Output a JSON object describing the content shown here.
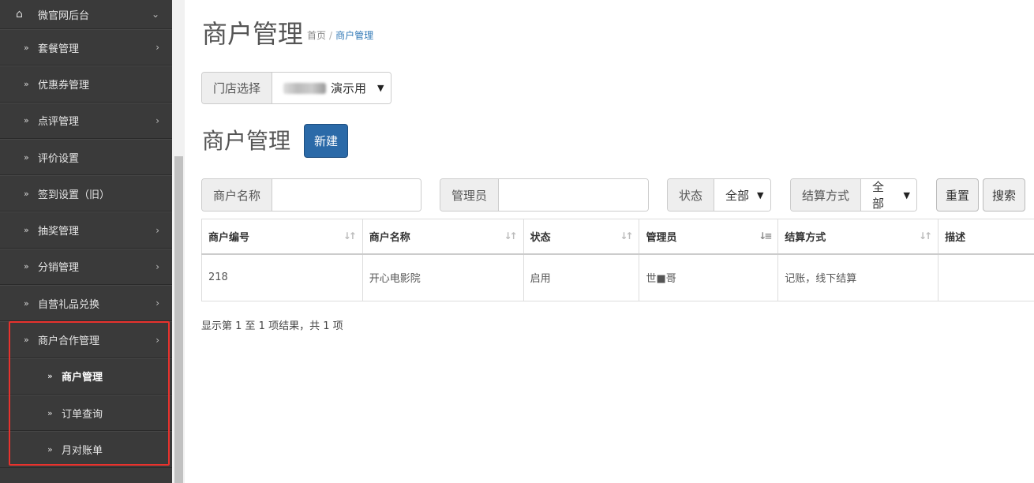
{
  "sidebar": {
    "top": {
      "label": "微官网后台",
      "icon": "home-icon"
    },
    "items": [
      {
        "label": "套餐管理",
        "has_arrow": true
      },
      {
        "label": "优惠券管理",
        "has_arrow": false
      },
      {
        "label": "点评管理",
        "has_arrow": true
      },
      {
        "label": "评价设置",
        "has_arrow": false
      },
      {
        "label": "签到设置（旧）",
        "has_arrow": false
      },
      {
        "label": "抽奖管理",
        "has_arrow": true
      },
      {
        "label": "分销管理",
        "has_arrow": true
      },
      {
        "label": "自营礼品兑换",
        "has_arrow": true
      },
      {
        "label": "商户合作管理",
        "has_arrow": true
      }
    ],
    "sub_items": [
      {
        "label": "商户管理",
        "active": true
      },
      {
        "label": "订单查询",
        "active": false
      },
      {
        "label": "月对账单",
        "active": false
      }
    ]
  },
  "header": {
    "title": "商户管理",
    "breadcrumb": {
      "home": "首页",
      "separator": "/",
      "current": "商户管理"
    }
  },
  "store_select": {
    "label": "门店选择",
    "value": "演示用"
  },
  "section": {
    "title": "商户管理",
    "new_button": "新建"
  },
  "filters": {
    "merchant_name_label": "商户名称",
    "merchant_name_value": "",
    "admin_label": "管理员",
    "admin_value": "",
    "status_label": "状态",
    "status_value": "全部",
    "settle_label": "结算方式",
    "settle_value": "全部",
    "reset_button": "重置",
    "search_button": "搜索"
  },
  "table": {
    "headers": [
      "商户编号",
      "商户名称",
      "状态",
      "管理员",
      "结算方式",
      "描述"
    ],
    "rows": [
      [
        "218",
        "开心电影院",
        "启用",
        "世■哥",
        "记账，线下结算",
        ""
      ]
    ]
  },
  "pagination_info": "显示第 1 至 1 项结果，共 1 项",
  "colors": {
    "sidebar_bg": "#3a3a3a",
    "primary": "#2b6aa8",
    "highlight": "#e8322d",
    "link": "#337ab7"
  }
}
